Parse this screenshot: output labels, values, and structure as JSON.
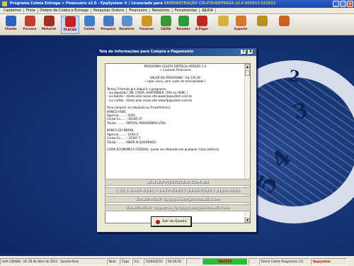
{
  "window": {
    "title": "Programa Coleta Entrega + Financeiro v2.0 - FpqSystem ® | Licenciado para ",
    "license": "DEMONSTRAÇÃO COLETA/ENTREGA v2.0 902013 015011",
    "icon": "app-icon"
  },
  "menu": [
    "Cadastros",
    "Frota",
    "Ordem de Coleta e Entrega",
    "Pesquisar Ordens",
    "Financeiro",
    "Relatórios",
    "Ferramentas",
    "AJUDA"
  ],
  "toolbar": [
    {
      "label": "Cliente",
      "icon": "client-icon",
      "color": "#3060c0"
    },
    {
      "label": "Fornece",
      "icon": "supplier-icon",
      "color": "#c04030"
    },
    {
      "label": "Motorist",
      "icon": "driver-icon",
      "color": "#a03020"
    },
    {
      "label": "PLACAS",
      "icon": "truck-icon",
      "color": "#c82020"
    },
    {
      "label": "Coleta",
      "icon": "collect-icon",
      "color": "#3a80c8"
    },
    {
      "label": "Pesquisa",
      "icon": "search-icon",
      "color": "#4878c0"
    },
    {
      "label": "Relatório",
      "icon": "report-icon",
      "color": "#5890d0"
    },
    {
      "label": "Financei",
      "icon": "finance-icon",
      "color": "#c89a20"
    },
    {
      "label": "CAIXA",
      "icon": "cash-icon",
      "color": "#389838"
    },
    {
      "label": "Receber",
      "icon": "receive-icon",
      "color": "#2a9a3a"
    },
    {
      "label": "A Pagar",
      "icon": "pay-icon",
      "color": "#c02828"
    },
    {
      "label": "",
      "icon": "calculator-icon",
      "color": "#d8b040"
    },
    {
      "label": "Suporte",
      "icon": "support-icon",
      "color": "#d07830"
    },
    {
      "label": "",
      "icon": "tools-icon",
      "color": "#b89020"
    },
    {
      "label": "",
      "icon": "exit-door-icon",
      "color": "#d06020"
    }
  ],
  "clock_digits": [
    "2",
    "3",
    "4",
    "5",
    "6"
  ],
  "dialog": {
    "title": "Tela de Informações para Compra e Pagamento",
    "help_label": "?",
    "close_label": "X",
    "info_lines": [
      {
        "text": "PROGRAMA COLETA ENTREGA VERSÃO 2.0",
        "center": true
      },
      {
        "text": "+ Controle Financeiro",
        "center": true
      },
      {
        "text": "",
        "gap": true
      },
      {
        "text": "VALOR DO PROGRAMA : R$ 135,00",
        "center": true
      },
      {
        "text": "( valor unico, sem custo de mensalidade )",
        "center": true
      },
      {
        "text": "",
        "gap": true
      },
      {
        "text": "Temos 3 formas pra adquirir o programa:"
      },
      {
        "text": "- via depósito ( BB, CAIXA, SANTANDER, ITAU ou HSBC )"
      },
      {
        "text": "- via boleto - direto pelo nosso site www.fpqsystem.com.br"
      },
      {
        "text": "- via cartão - direto pelo nosso site www.fpqsystem.com.br"
      },
      {
        "text": "",
        "gap": true
      },
      {
        "text": "Para comprar via depósito ou Transferência:"
      },
      {
        "text": "BANCO HSBC"
      },
      {
        "text": "Agencia........: 0050"
      },
      {
        "text": "Conta Co.......: 00185-37"
      },
      {
        "text": "Titular.........: VIRTUAL PROGRAMAS LTDA"
      },
      {
        "text": "",
        "gap": true
      },
      {
        "text": "BANCO DO BRASIL"
      },
      {
        "text": "Agencia........: 1430-3"
      },
      {
        "text": "Conta Co.......: 22307-7"
      },
      {
        "text": "Titular.........: ANAIR N QUADRADO"
      },
      {
        "text": "",
        "gap": true
      },
      {
        "text": "CAIXA ECONOMICA FEDERAL: (pode ser efetuado em qualquer Casa Lotérica)"
      }
    ],
    "scroll_up": "▲",
    "scroll_down": "▼",
    "website": "WWW.FPQSYSTEM.COM.BR",
    "phones": "( 61 ) 3447-6881 / 3447-6995 / 3443-7592 / 9139-6089",
    "email1": "Email/MSN: fpqsystem@hotmail.com",
    "email2": "Email/MSN: suporte_fpqsystem@hotmail.com",
    "exit_label": "Sair do Quadro"
  },
  "status": {
    "city_date": "SUA CIDADE - UF 20 de Abril de 2011 - Quarta-feira",
    "num": "Num",
    "caps": "Caps",
    "ins": "Ins",
    "date": "20/04/2011",
    "time": "04:16:20",
    "master": "MASTER",
    "edition": "Demo Coleta Programas 2.0",
    "brand": "fpqsystem"
  }
}
